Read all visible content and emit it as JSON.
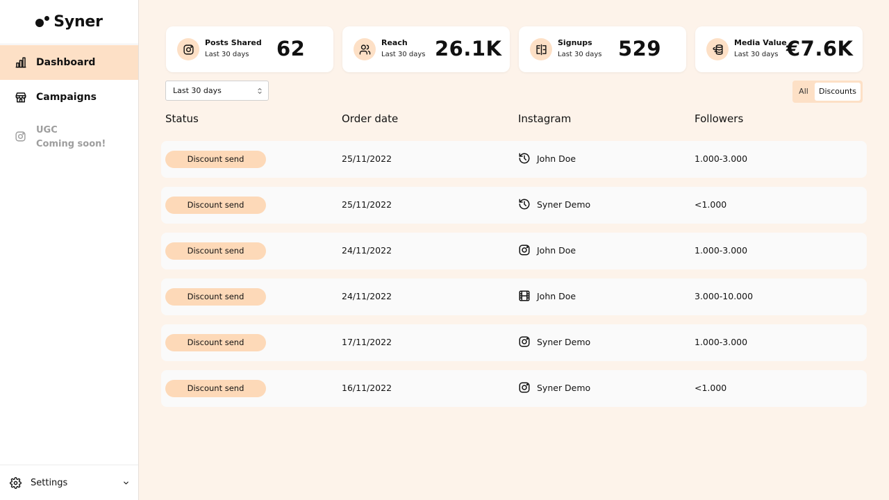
{
  "app": {
    "name": "Syner"
  },
  "sidebar": {
    "items": [
      {
        "label": "Dashboard",
        "icon": "bar-chart-icon",
        "active": true
      },
      {
        "label": "Campaigns",
        "icon": "store-icon",
        "active": false
      }
    ],
    "ugc": {
      "label": "UGC",
      "note": "Coming soon!",
      "icon": "instagram-icon"
    },
    "settings_label": "Settings"
  },
  "stats": [
    {
      "label": "Posts Shared",
      "period": "Last 30 days",
      "value": "62",
      "icon": "instagram-icon"
    },
    {
      "label": "Reach",
      "period": "Last 30 days",
      "value": "26.1K",
      "icon": "users-icon"
    },
    {
      "label": "Signups",
      "period": "Last 30 days",
      "value": "529",
      "icon": "signup-icon"
    },
    {
      "label": "Media Value",
      "period": "Last 30 days",
      "value": "€7.6K",
      "icon": "coins-icon"
    }
  ],
  "filter": {
    "period_selected": "Last 30 days"
  },
  "toggle": {
    "all_label": "All",
    "discounts_label": "Discounts",
    "selected": "Discounts"
  },
  "accent_color": "#fde0c6",
  "table": {
    "columns": [
      "Status",
      "Order date",
      "Instagram",
      "Followers"
    ],
    "rows": [
      {
        "status": "Discount send",
        "date": "25/11/2022",
        "icon": "history-icon",
        "instagram": "John Doe",
        "followers": "1.000-3.000"
      },
      {
        "status": "Discount send",
        "date": "25/11/2022",
        "icon": "history-icon",
        "instagram": "Syner Demo",
        "followers": "<1.000"
      },
      {
        "status": "Discount send",
        "date": "24/11/2022",
        "icon": "instagram-icon",
        "instagram": "John Doe",
        "followers": "1.000-3.000"
      },
      {
        "status": "Discount send",
        "date": "24/11/2022",
        "icon": "reel-icon",
        "instagram": "John Doe",
        "followers": "3.000-10.000"
      },
      {
        "status": "Discount send",
        "date": "17/11/2022",
        "icon": "instagram-icon",
        "instagram": "Syner Demo",
        "followers": "1.000-3.000"
      },
      {
        "status": "Discount send",
        "date": "16/11/2022",
        "icon": "instagram-icon",
        "instagram": "Syner Demo",
        "followers": "<1.000"
      }
    ]
  }
}
